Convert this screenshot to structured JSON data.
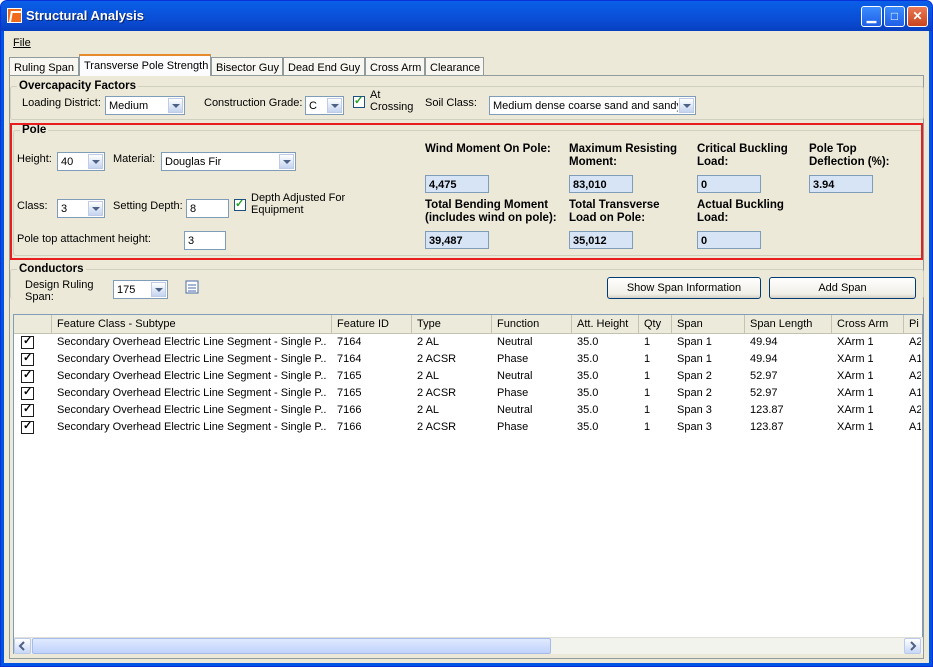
{
  "window": {
    "title": "Structural Analysis"
  },
  "menu": {
    "file": "File"
  },
  "tabs": [
    "Ruling Span",
    "Transverse Pole Strength",
    "Bisector Guy",
    "Dead End Guy",
    "Cross Arm",
    "Clearance"
  ],
  "overcapacity": {
    "title": "Overcapacity Factors",
    "loading_district_label": "Loading District:",
    "loading_district_value": "Medium",
    "construction_grade_label": "Construction Grade:",
    "construction_grade_value": "C",
    "at_crossing_label": "At Crossing",
    "soil_class_label": "Soil Class:",
    "soil_class_value": "Medium dense coarse sand and sandy"
  },
  "pole": {
    "title": "Pole",
    "height_label": "Height:",
    "height_value": "40",
    "material_label": "Material:",
    "material_value": "Douglas Fir",
    "class_label": "Class:",
    "class_value": "3",
    "setting_depth_label": "Setting Depth:",
    "setting_depth_value": "8",
    "depth_adjusted_label": "Depth Adjusted For Equipment",
    "attachment_height_label": "Pole top attachment height:",
    "attachment_height_value": "3",
    "results": {
      "wind_moment_label": "Wind Moment On Pole:",
      "wind_moment_value": "4,475",
      "max_resisting_label": "Maximum Resisting Moment:",
      "max_resisting_value": "83,010",
      "critical_buckling_label": "Critical Buckling Load:",
      "critical_buckling_value": "0",
      "deflection_label": "Pole Top Deflection (%):",
      "deflection_value": "3.94",
      "total_bending_label": "Total Bending Moment (includes wind on pole):",
      "total_bending_value": "39,487",
      "total_transverse_label": "Total Transverse Load on Pole:",
      "total_transverse_value": "35,012",
      "actual_buckling_label": "Actual Buckling Load:",
      "actual_buckling_value": "0"
    }
  },
  "conductors": {
    "title": "Conductors",
    "design_ruling_span_label": "Design Ruling Span:",
    "design_ruling_span_value": "175",
    "show_span_button": "Show Span Information",
    "add_span_button": "Add Span",
    "columns": [
      "",
      "Feature Class - Subtype",
      "Feature ID",
      "Type",
      "Function",
      "Att. Height",
      "Qty",
      "Span",
      "Span Length",
      "Cross Arm",
      "Pi"
    ],
    "rows": [
      [
        "Secondary Overhead Electric Line Segment - Single P...",
        "7164",
        "2 AL",
        "Neutral",
        "35.0",
        "1",
        "Span 1",
        "49.94",
        "XArm 1",
        "A2"
      ],
      [
        "Secondary Overhead Electric Line Segment - Single P...",
        "7164",
        "2 ACSR",
        "Phase",
        "35.0",
        "1",
        "Span 1",
        "49.94",
        "XArm 1",
        "A1"
      ],
      [
        "Secondary Overhead Electric Line Segment - Single P...",
        "7165",
        "2 AL",
        "Neutral",
        "35.0",
        "1",
        "Span 2",
        "52.97",
        "XArm 1",
        "A2"
      ],
      [
        "Secondary Overhead Electric Line Segment - Single P...",
        "7165",
        "2 ACSR",
        "Phase",
        "35.0",
        "1",
        "Span 2",
        "52.97",
        "XArm 1",
        "A1"
      ],
      [
        "Secondary Overhead Electric Line Segment - Single P...",
        "7166",
        "2 AL",
        "Neutral",
        "35.0",
        "1",
        "Span 3",
        "123.87",
        "XArm 1",
        "A2"
      ],
      [
        "Secondary Overhead Electric Line Segment - Single P...",
        "7166",
        "2 ACSR",
        "Phase",
        "35.0",
        "1",
        "Span 3",
        "123.87",
        "XArm 1",
        "A1"
      ]
    ]
  }
}
